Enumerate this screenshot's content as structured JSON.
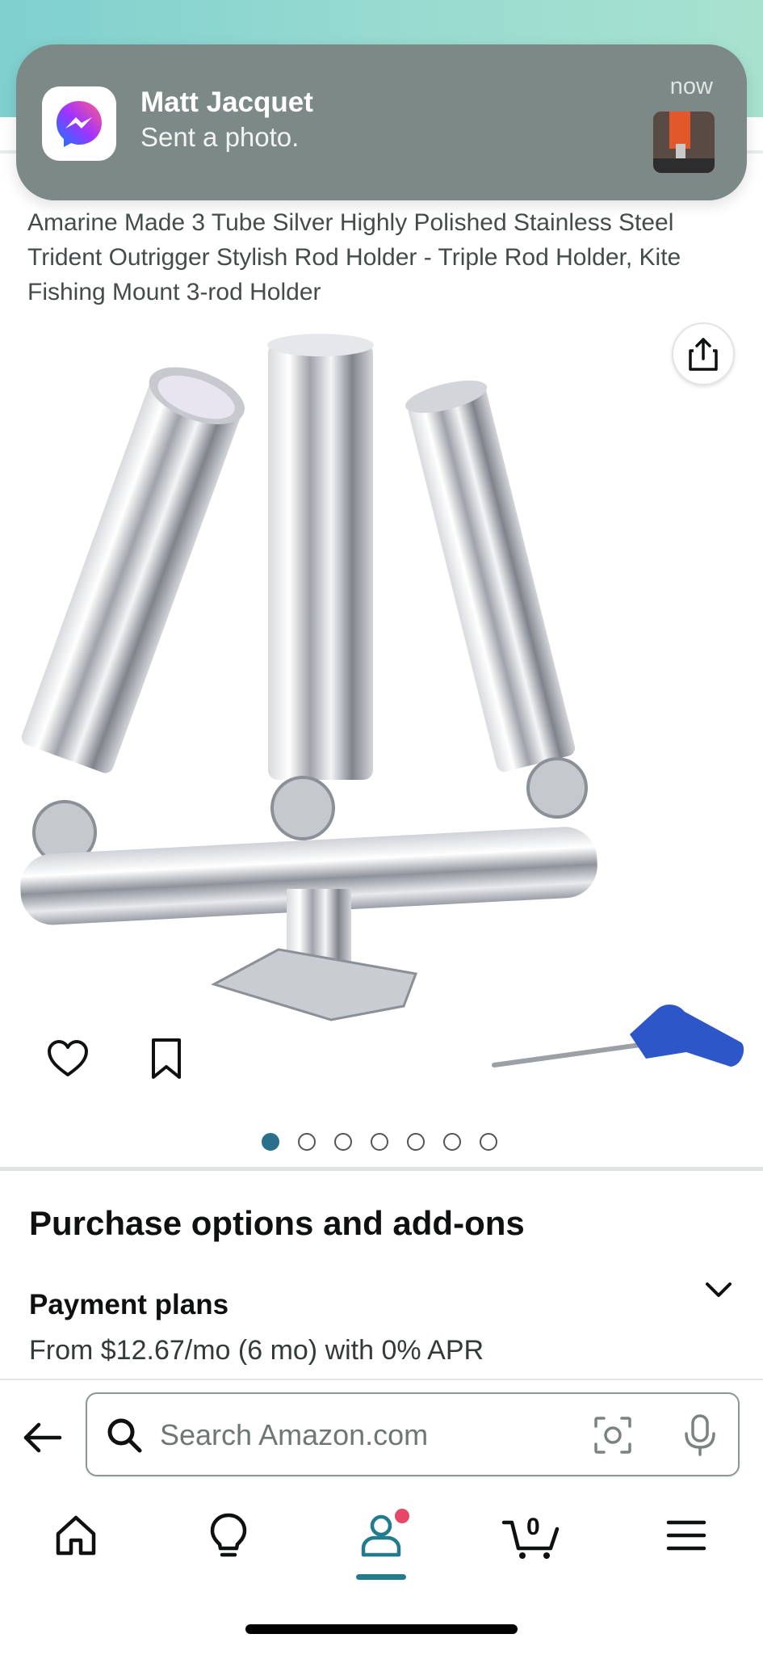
{
  "notification": {
    "sender": "Matt Jacquet",
    "message": "Sent a photo.",
    "time": "now",
    "app_icon": "messenger-icon"
  },
  "product": {
    "title": "Amarine Made 3 Tube Silver Highly Polished Stainless Steel Trident Outrigger Stylish Rod Holder - Triple Rod Holder, Kite Fishing Mount 3-rod Holder",
    "image_count": 7,
    "active_image_index": 0
  },
  "purchase": {
    "section_title": "Purchase options and add-ons",
    "payment_label": "Payment plans",
    "payment_detail": "From $12.67/mo (6 mo) with 0% APR"
  },
  "search": {
    "placeholder": "Search Amazon.com"
  },
  "bottom_nav": {
    "items": [
      "home-icon",
      "lightbulb-icon",
      "account-icon",
      "cart-icon",
      "menu-icon"
    ],
    "cart_count": "0",
    "active_item": "account"
  },
  "colors": {
    "accent": "#227c8e",
    "badge": "#e64767",
    "notification_bg": "#7c8987"
  }
}
